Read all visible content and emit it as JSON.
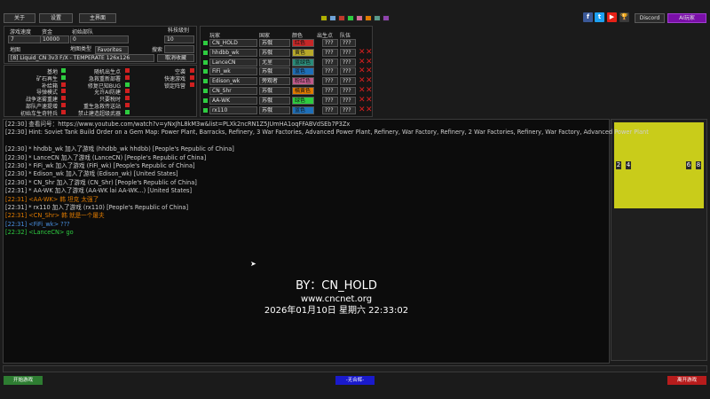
{
  "topbar": {
    "about": "关于",
    "settings": "设置",
    "mainmenu": "主界面",
    "discord": "Discord",
    "ai_room": "AI玩家",
    "swatches": [
      "#b0b000",
      "#6fa3d8",
      "#c0392b",
      "#2ecc40",
      "#d46a9b",
      "#e07b00",
      "#5a9a8a",
      "#8e44ad"
    ]
  },
  "settings_panel": {
    "game_speed_label": "游戏速度",
    "game_speed_value": "7",
    "credits_label": "资金",
    "credits_value": "10000",
    "start_units_label": "初始部队",
    "start_units_value": "0",
    "tech_label": "科技级别",
    "tech_value": "10",
    "map_label": "地图",
    "maptype_label": "地图类型",
    "maptype_value": "Favorites",
    "search_label": "搜索",
    "map_value": "[8] Liquid_CN 3v3 F/X - TEMPERATE 126x126",
    "cancel_fav": "取消收藏"
  },
  "options": {
    "col1": [
      {
        "label": "基地",
        "on": true
      },
      {
        "label": "矿石再生",
        "on": true
      },
      {
        "label": "补给箱",
        "on": false
      },
      {
        "label": "导弹模式",
        "on": false
      },
      {
        "label": "战争迷雾重建",
        "on": false
      },
      {
        "label": "部队产速提增",
        "on": false
      },
      {
        "label": "初始车生奇特兵",
        "on": false
      }
    ],
    "col2": [
      {
        "label": "随机出生点",
        "on": false
      },
      {
        "label": "急救重新部署",
        "on": false
      },
      {
        "label": "修复已知BUG",
        "on": true
      },
      {
        "label": "允许AI防建",
        "on": false
      },
      {
        "label": "只要税时",
        "on": false
      },
      {
        "label": "重生急救传送站",
        "on": false
      },
      {
        "label": "禁止建造超级武器",
        "on": true
      }
    ],
    "col3": [
      {
        "label": "空袭",
        "on": false
      },
      {
        "label": "快速游戏",
        "on": false
      },
      {
        "label": "锁定阵营",
        "on": false
      }
    ]
  },
  "players": {
    "headers": {
      "player": "玩家",
      "country": "国家",
      "color": "颜色",
      "start": "出生点",
      "team": "队伍"
    },
    "rows": [
      {
        "name": "CN_HOLD",
        "country": "苏俄",
        "color": "红色",
        "color_hex": "#c62828",
        "start": "???",
        "team": "???",
        "removable": false
      },
      {
        "name": "hhdbb_wk",
        "country": "苏俄",
        "color": "黄色",
        "color_hex": "#b8a92a",
        "start": "???",
        "team": "???",
        "removable": true
      },
      {
        "name": "LanceCN",
        "country": "尤里",
        "color": "蓝绿色",
        "color_hex": "#2a8c7a",
        "start": "???",
        "team": "???",
        "removable": true
      },
      {
        "name": "FiFi_wk",
        "country": "苏俄",
        "color": "蓝色",
        "color_hex": "#1e6fb8",
        "start": "???",
        "team": "???",
        "removable": true
      },
      {
        "name": "Edison_wk",
        "country": "旁观者",
        "color": "粉红色",
        "color_hex": "#c05a8a",
        "start": "???",
        "team": "???",
        "removable": true
      },
      {
        "name": "CN_Shr",
        "country": "苏俄",
        "color": "橘黄色",
        "color_hex": "#e07b00",
        "start": "???",
        "team": "???",
        "removable": true
      },
      {
        "name": "AA-WK",
        "country": "苏俄",
        "color": "绿色",
        "color_hex": "#2ecc40",
        "start": "???",
        "team": "???",
        "removable": true
      },
      {
        "name": "rx110",
        "country": "苏俄",
        "color": "蓝色",
        "color_hex": "#1e6fb8",
        "start": "???",
        "team": "???",
        "removable": true
      }
    ]
  },
  "chat": [
    {
      "text": "[22:30] 查看问号：https://www.youtube.com/watch?v=yNxJhL8kM3w&list=PLXk2ncRN1Z5JUmHA1oqFFABVdSEb7P3Zx",
      "color": "#cfcfcf"
    },
    {
      "text": "[22:30] Hint: Soviet Tank Build Order on a Gem Map: Power Plant, Barracks, Refinery, 3 War Factories, Advanced Power Plant, Refinery, War Factory, Refinery, 2 War Factories, Refinery, War Factory, Advanced Power Plant",
      "color": "#cfcfcf"
    },
    {
      "text": "",
      "color": "#cfcfcf"
    },
    {
      "text": "[22:30] * hhdbb_wk 加入了游戏 (hhdbb_wk hhdbb) [People's Republic of China]",
      "color": "#cfcfcf"
    },
    {
      "text": "[22:30] * LanceCN 加入了游戏 (LanceCN) [People's Republic of China]",
      "color": "#cfcfcf"
    },
    {
      "text": "[22:30] * FiFi_wk 加入了游戏 (FiFi_wk) [People's Republic of China]",
      "color": "#cfcfcf"
    },
    {
      "text": "[22:30] * Edison_wk 加入了游戏 (Edison_wk) [United States]",
      "color": "#cfcfcf"
    },
    {
      "text": "[22:30] * CN_Shr 加入了游戏 (CN_Shr) [People's Republic of China]",
      "color": "#cfcfcf"
    },
    {
      "text": "[22:31] * AA-WK 加入了游戏 (AA-WK lai AA-WK...) [United States]",
      "color": "#cfcfcf"
    },
    {
      "text": "[22:31] <AA-WK> 韩 坦克 太强了",
      "color": "#e07b00"
    },
    {
      "text": "[22:31] * rx110 加入了游戏 (rx110) [People's Republic of China]",
      "color": "#cfcfcf"
    },
    {
      "text": "[22:31] <CN_Shr> 韩 就是一个屠夫",
      "color": "#e07b00"
    },
    {
      "text": "[22:31] <FiFi_wk> ???",
      "color": "#4a90e2"
    },
    {
      "text": "[22:32] <LanceCN> go",
      "color": "#2ecc40"
    }
  ],
  "watermark": {
    "author": "BY：CN_HOLD",
    "site": "www.cncnet.org",
    "datetime": "2026年01月10日 星期六 22:33:02"
  },
  "minimap": {
    "left_labels": [
      "2",
      "4"
    ],
    "right_labels": [
      "6",
      "8"
    ],
    "color": "#c9cc1a"
  },
  "bottom": {
    "start": "开始游戏",
    "no_vote": "-无合辉-",
    "leave": "离开游戏"
  }
}
